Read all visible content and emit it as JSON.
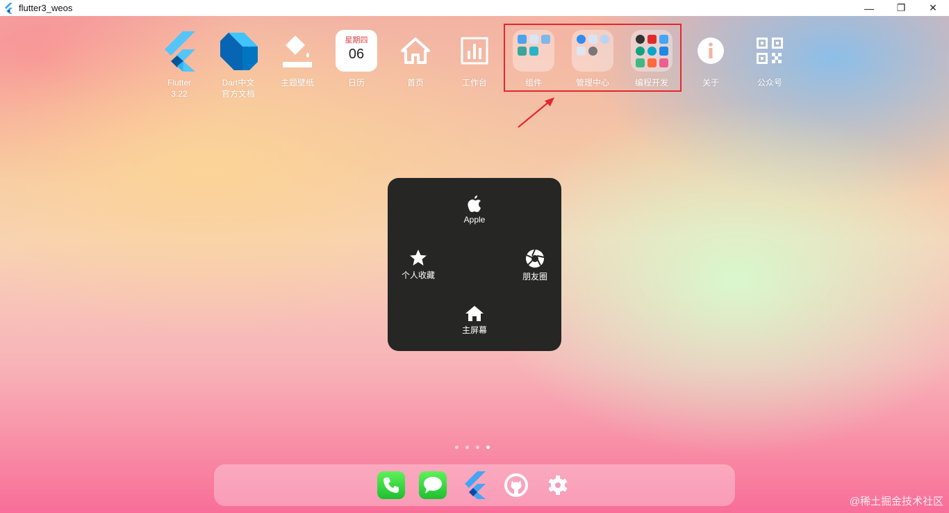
{
  "window": {
    "title": "flutter3_weos",
    "minimize": "—",
    "restore": "❐",
    "close": "✕"
  },
  "apps": [
    {
      "label_line1": "Flutter",
      "label_line2": "3.22"
    },
    {
      "label_line1": "Dart中文",
      "label_line2": "官方文档"
    },
    {
      "label_line1": "主题壁纸",
      "label_line2": ""
    },
    {
      "label_line1": "日历",
      "label_line2": "",
      "weekday": "星期四",
      "day": "06"
    },
    {
      "label_line1": "首页",
      "label_line2": ""
    },
    {
      "label_line1": "工作台",
      "label_line2": ""
    },
    {
      "label_line1": "组件",
      "label_line2": ""
    },
    {
      "label_line1": "管理中心",
      "label_line2": ""
    },
    {
      "label_line1": "编程开发",
      "label_line2": ""
    },
    {
      "label_line1": "关于",
      "label_line2": ""
    },
    {
      "label_line1": "公众号",
      "label_line2": ""
    }
  ],
  "assistive_touch": {
    "top": "Apple",
    "left": "个人收藏",
    "right": "朋友圈",
    "bottom": "主屏幕"
  },
  "pages": {
    "count": 4,
    "active": 4
  },
  "dock": [
    "phone-icon",
    "messages-icon",
    "flutter-icon",
    "github-icon",
    "settings-icon"
  ],
  "watermark": "@稀土掘金技术社区",
  "colors": {
    "highlight": "#e5272d",
    "panel": "#262625",
    "flutter_blue": "#42a5f5",
    "dart_blue": "#0175c2"
  }
}
